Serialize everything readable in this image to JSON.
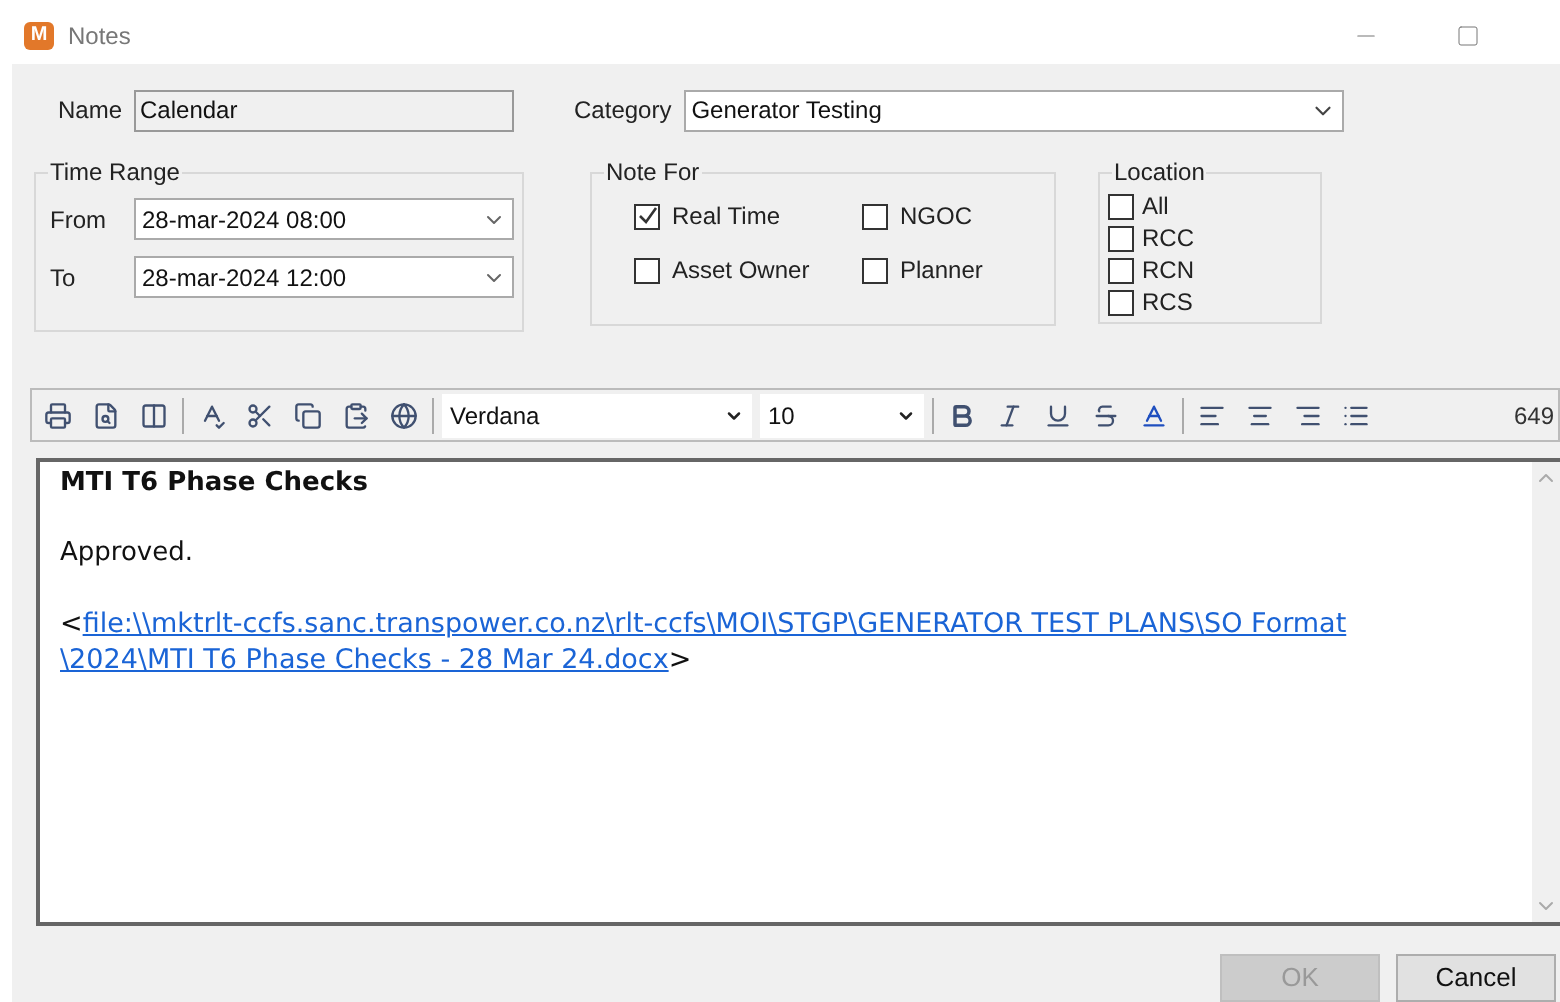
{
  "window": {
    "title": "Notes",
    "icon_letter": "M"
  },
  "name": {
    "label": "Name",
    "value": "Calendar"
  },
  "category": {
    "label": "Category",
    "value": "Generator Testing"
  },
  "time_range": {
    "title": "Time Range",
    "fields": [
      {
        "label": "From",
        "value": "28-mar-2024 08:00"
      },
      {
        "label": "To",
        "value": "28-mar-2024 12:00"
      }
    ]
  },
  "note_for": {
    "title": "Note For",
    "options": [
      {
        "label": "Real Time",
        "checked": true
      },
      {
        "label": "NGOC",
        "checked": false
      },
      {
        "label": "Asset Owner",
        "checked": false
      },
      {
        "label": "Planner",
        "checked": false
      }
    ]
  },
  "location": {
    "title": "Location",
    "options": [
      {
        "label": "All",
        "checked": false
      },
      {
        "label": "RCC",
        "checked": false
      },
      {
        "label": "RCN",
        "checked": false
      },
      {
        "label": "RCS",
        "checked": false
      }
    ]
  },
  "toolbar": {
    "font": "Verdana",
    "size": "10",
    "count": "649"
  },
  "editor": {
    "heading": "MTI T6 Phase Checks",
    "paragraph": "Approved.",
    "link_open": "<",
    "link_lines": [
      "file:\\\\mktrlt-ccfs.sanc.transpower.co.nz\\rlt-ccfs\\MOI\\STGP\\GENERATOR TEST PLANS\\SO Format",
      "\\2024\\MTI T6 Phase Checks - 28 Mar 24.docx"
    ],
    "link_close": ">"
  },
  "buttons": [
    {
      "label": "OK",
      "disabled": true
    },
    {
      "label": "Cancel",
      "disabled": false
    }
  ]
}
